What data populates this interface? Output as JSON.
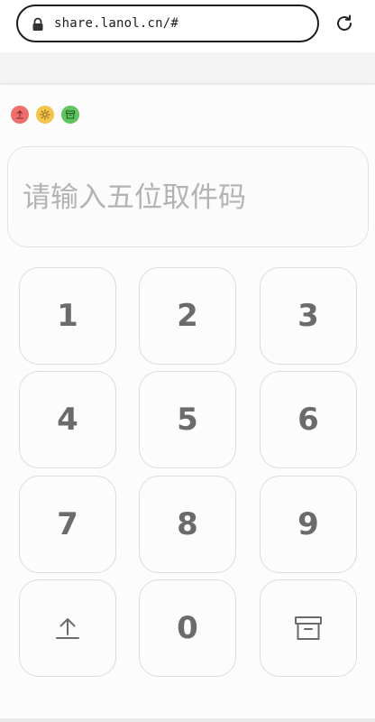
{
  "browser": {
    "url": "share.lanol.cn/#",
    "lock_icon": "lock-icon",
    "reload_icon": "reload-icon"
  },
  "window_controls": [
    {
      "name": "upload-control",
      "icon": "upload-icon",
      "color": "#ee6e6e"
    },
    {
      "name": "theme-control",
      "icon": "sun-icon",
      "color": "#f3c54c"
    },
    {
      "name": "box-control",
      "icon": "archive-icon",
      "color": "#5fc45f"
    }
  ],
  "code_input": {
    "placeholder": "请输入五位取件码",
    "value": ""
  },
  "keypad": {
    "keys": [
      "1",
      "2",
      "3",
      "4",
      "5",
      "6",
      "7",
      "8",
      "9",
      "0"
    ],
    "upload_key_icon": "upload-icon",
    "archive_key_icon": "archive-icon"
  },
  "colors": {
    "key_text": "#6b6b6b",
    "placeholder": "#b3b3b3",
    "red": "#ee6e6e",
    "yellow": "#f3c54c",
    "green": "#5fc45f"
  }
}
